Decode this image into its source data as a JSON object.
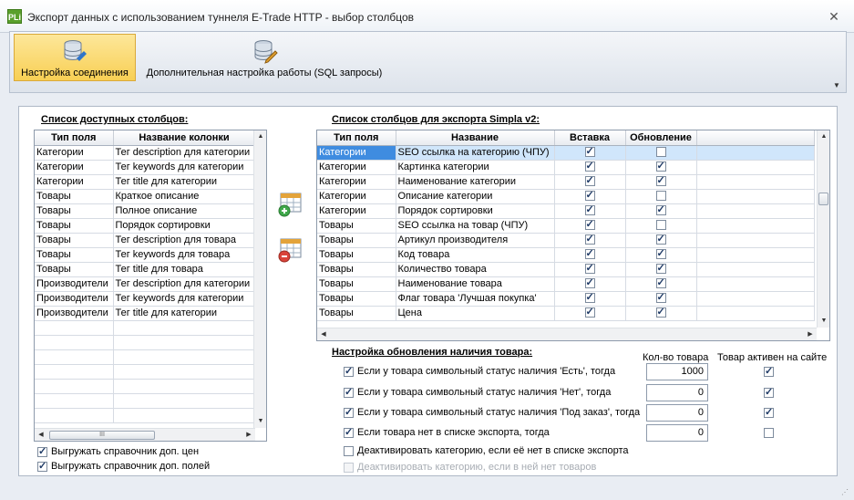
{
  "window": {
    "icon_text": "PLi",
    "title": "Экспорт данных с использованием туннеля E-Trade HTTP - выбор столбцов",
    "close_glyph": "✕"
  },
  "ribbon": {
    "tab_connection": "Настройка соединения",
    "tab_advanced": "Дополнительная настройка работы (SQL запросы)"
  },
  "available": {
    "title": "Список доступных столбцов:",
    "headers": [
      "Тип поля",
      "Название колонки"
    ],
    "rows": [
      [
        "Категории",
        "Тег description для категории"
      ],
      [
        "Категории",
        "Тег keywords для категории"
      ],
      [
        "Категории",
        "Тег title для категории"
      ],
      [
        "Товары",
        "Краткое описание"
      ],
      [
        "Товары",
        "Полное описание"
      ],
      [
        "Товары",
        "Порядок сортировки"
      ],
      [
        "Товары",
        "Тег description для товара"
      ],
      [
        "Товары",
        "Тег keywords для товара"
      ],
      [
        "Товары",
        "Тег title для товара"
      ],
      [
        "Производители",
        "Тег description для категории"
      ],
      [
        "Производители",
        "Тег keywords для категории"
      ],
      [
        "Производители",
        "Тег title для категории"
      ]
    ],
    "hscroll_thumb": "III"
  },
  "export": {
    "title": "Список столбцов для экспорта Simpla v2:",
    "headers": [
      "Тип поля",
      "Название",
      "Вставка",
      "Обновление"
    ],
    "rows": [
      {
        "type": "Категории",
        "name": "SEO ссылка на категорию (ЧПУ)",
        "insert": true,
        "update": false
      },
      {
        "type": "Категории",
        "name": "Картинка категории",
        "insert": true,
        "update": true
      },
      {
        "type": "Категории",
        "name": "Наименование категории",
        "insert": true,
        "update": true
      },
      {
        "type": "Категории",
        "name": "Описание категории",
        "insert": true,
        "update": false
      },
      {
        "type": "Категории",
        "name": "Порядок сортировки",
        "insert": true,
        "update": true
      },
      {
        "type": "Товары",
        "name": "SEO ссылка на товар (ЧПУ)",
        "insert": true,
        "update": false
      },
      {
        "type": "Товары",
        "name": "Артикул производителя",
        "insert": true,
        "update": true
      },
      {
        "type": "Товары",
        "name": "Код товара",
        "insert": true,
        "update": true
      },
      {
        "type": "Товары",
        "name": "Количество товара",
        "insert": true,
        "update": true
      },
      {
        "type": "Товары",
        "name": "Наименование товара",
        "insert": true,
        "update": true
      },
      {
        "type": "Товары",
        "name": "Флаг товара 'Лучшая покупка'",
        "insert": true,
        "update": true
      },
      {
        "type": "Товары",
        "name": "Цена",
        "insert": true,
        "update": true
      }
    ]
  },
  "options": {
    "export_price_ref": {
      "label": "Выгружать справочник доп. цен",
      "checked": true
    },
    "export_field_ref": {
      "label": "Выгружать справочник доп. полей",
      "checked": true
    }
  },
  "stock": {
    "title": "Настройка обновления наличия товара:",
    "col_qty": "Кол-во товара",
    "col_active": "Товар активен на сайте",
    "rows": [
      {
        "label": "Если у товара символьный статус наличия 'Есть', тогда",
        "checked": true,
        "qty": "1000",
        "active": true
      },
      {
        "label": "Если у товара символьный статус наличия 'Нет', тогда",
        "checked": true,
        "qty": "0",
        "active": true
      },
      {
        "label": "Если у товара символьный статус наличия 'Под заказ', тогда",
        "checked": true,
        "qty": "0",
        "active": true
      },
      {
        "label": "Если товара нет в списке экспорта, тогда",
        "checked": true,
        "qty": "0",
        "active": false
      }
    ],
    "deactivate_missing": {
      "label": "Деактивировать категорию, если её нет в списке экспорта",
      "checked": false
    },
    "deactivate_empty": {
      "label": "Деактивировать категорию, если в ней нет товаров",
      "checked": false
    }
  },
  "colors": {
    "accent": "#3f8ce0",
    "ribbon_active": "#f8cf54",
    "selected_row": "#d0e6fb"
  }
}
